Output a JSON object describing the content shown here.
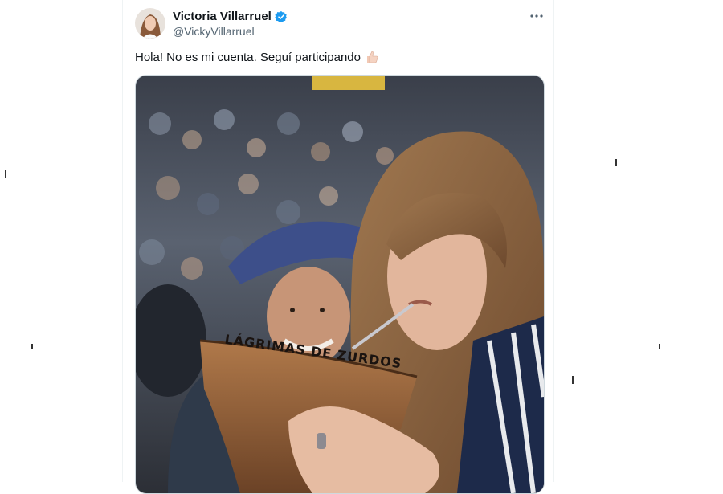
{
  "author": {
    "name": "Victoria Villarruel",
    "handle": "@VickyVillarruel",
    "verified": true,
    "avatar_icon": "profile-photo"
  },
  "tweet": {
    "text": "Hola! No es mi cuenta. Seguí participando",
    "emoji_icon": "thumbs-up-icon"
  },
  "media": {
    "description_icon": "photo",
    "mate_inscription": "LÁGRIMAS DE ZURDOS"
  },
  "colors": {
    "verified": "#1d9bf0",
    "text_primary": "#0f1419",
    "text_secondary": "#536471"
  },
  "menu": {
    "icon": "more-icon"
  }
}
